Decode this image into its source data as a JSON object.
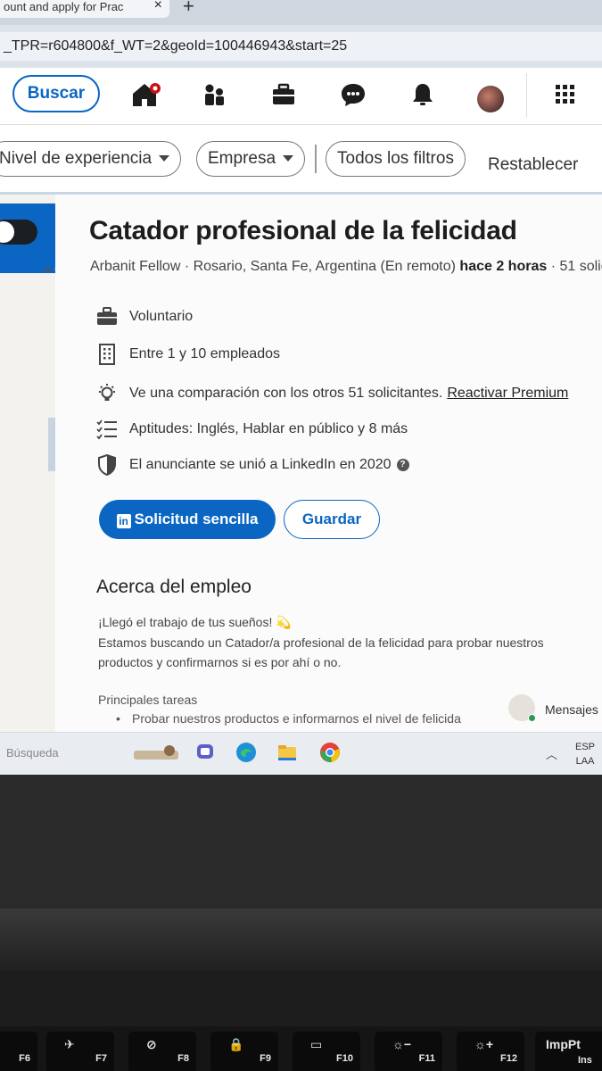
{
  "browser": {
    "tab_title": "ount and apply for Prac",
    "new_tab": "+",
    "tab_close": "×",
    "url": "_TPR=r604800&f_WT=2&geoId=100446943&start=25"
  },
  "nav": {
    "search_label": "Buscar"
  },
  "filters": {
    "experience": "Nivel de experiencia",
    "company": "Empresa",
    "all_filters": "Todos los filtros",
    "reset": "Restablecer"
  },
  "job": {
    "title": "Catador profesional de la felicidad",
    "company": "Arbanit Fellow",
    "location": "Rosario, Santa Fe, Argentina (En remoto)",
    "posted": "hace 2 horas",
    "applicants": "51 solic",
    "workplace": "Voluntario",
    "company_size": "Entre 1 y 10 empleados",
    "comparison": "Ve una comparación con los otros 51 solicitantes.",
    "premium_link": "Reactivar Premium",
    "skills": "Aptitudes: Inglés, Hablar en público y 8 más",
    "joined": "El anunciante se unió a LinkedIn en 2020",
    "apply_label": "Solicitud sencilla",
    "save_label": "Guardar",
    "about_heading": "Acerca del empleo",
    "intro": "¡Llegó el trabajo de tus sueños! 💫",
    "desc_line1": "Estamos buscando un Catador/a profesional de la felicidad para probar nuestros",
    "desc_line2": "productos y confirmarnos si es por ahí o no.",
    "tasks_heading": "Principales tareas",
    "task_1": "Probar nuestros productos e informarnos el nivel de felicida"
  },
  "messages": {
    "label": "Mensajes"
  },
  "taskbar": {
    "search": "Búsqueda",
    "lang_1": "ESP",
    "lang_2": "LAA"
  },
  "keyboard": {
    "keys": [
      "F6",
      "F7",
      "F8",
      "F9",
      "F10",
      "F11",
      "F12",
      "ImpPt",
      "Ins"
    ]
  },
  "colors": {
    "brand_blue": "#0a66c2",
    "page_bg": "#f3f2ef"
  }
}
